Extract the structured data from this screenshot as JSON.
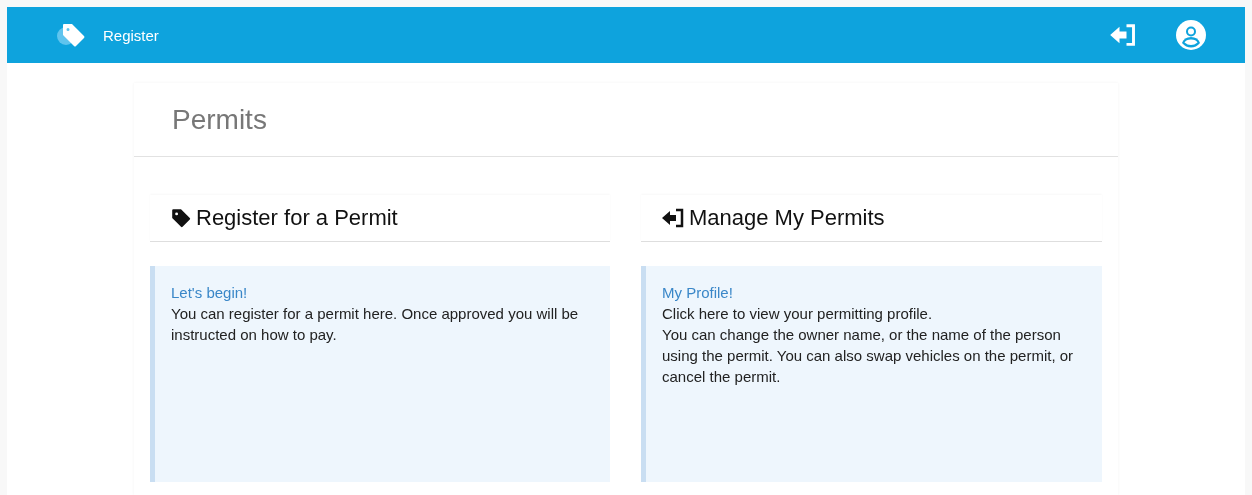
{
  "header": {
    "brand": "Register"
  },
  "page": {
    "title": "Permits"
  },
  "cards": [
    {
      "kind": "register",
      "title": "Register for a Permit",
      "link": "Let's begin!",
      "paragraphs": [
        "You can register for a permit here. Once approved you will be instructed on how to pay."
      ]
    },
    {
      "kind": "manage",
      "title": "Manage My Permits",
      "link": "My Profile!",
      "paragraphs": [
        "Click here to view your permitting profile.",
        "You can change the owner name, or the name of the person using the permit. You can also swap vehicles on the permit, or cancel the permit."
      ]
    }
  ]
}
